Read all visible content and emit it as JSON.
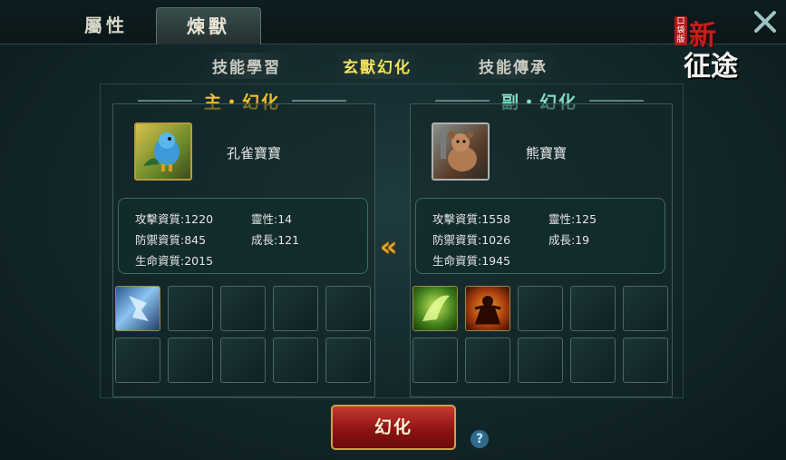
{
  "main_tabs": [
    "屬性",
    "煉獸"
  ],
  "logo": {
    "small": "口袋版",
    "title_top": "新",
    "title_bottom": "征途"
  },
  "sub_tabs": [
    "技能學習",
    "玄獸幻化",
    "技能傳承"
  ],
  "primary": {
    "header": "主・幻化",
    "pet_name": "孔雀寶寶",
    "stats": {
      "attack": "攻擊資質:1220",
      "spirit": "靈性:14",
      "defense": "防禦資質:845",
      "growth": "成長:121",
      "life": "生命資質:2015"
    },
    "skills_filled": 1
  },
  "secondary": {
    "header": "副・幻化",
    "pet_name": "熊寶寶",
    "stats": {
      "attack": "攻擊資質:1558",
      "spirit": "靈性:125",
      "defense": "防禦資質:1026",
      "growth": "成長:19",
      "life": "生命資質:1945"
    },
    "skills_filled": 2
  },
  "arrow": "«",
  "action_button": "幻化",
  "help": "?"
}
